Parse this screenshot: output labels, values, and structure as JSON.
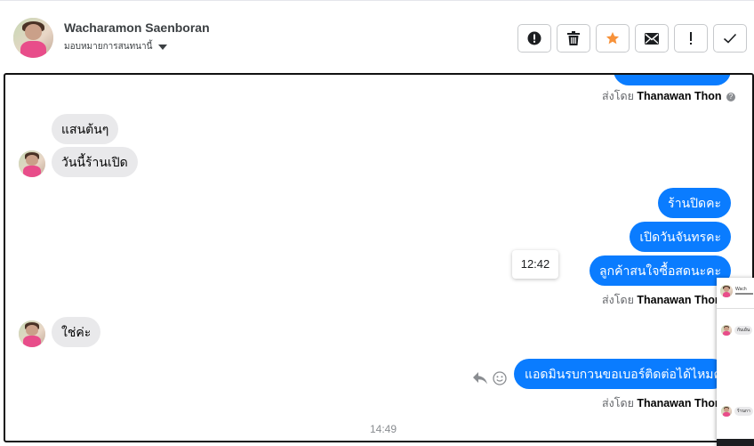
{
  "header": {
    "contact_name": "Wacharamon Saenboran",
    "assign_label": "มอบหมายการสนทนานี้"
  },
  "toolbar": {
    "buttons": [
      {
        "name": "spam",
        "icon": "alert-circle-icon"
      },
      {
        "name": "delete",
        "icon": "trash-icon"
      },
      {
        "name": "star",
        "icon": "star-icon",
        "color": "#f7923a"
      },
      {
        "name": "unread",
        "icon": "envelope-icon"
      },
      {
        "name": "follow-up",
        "icon": "exclamation-icon"
      },
      {
        "name": "done",
        "icon": "check-icon"
      }
    ]
  },
  "messages": {
    "sent_by_prefix": "ส่งโดย",
    "sender_name": "Thanawan Thon",
    "incoming": [
      "แสนต้นๆ",
      "วันนี้ร้านเปิด",
      "ใช่ค่ะ"
    ],
    "outgoing": [
      "ร้านปิดคะ",
      "เปิดวันจันทรคะ",
      "ลูกค้าสนใจซื้อสดนะคะ",
      "แอดมินรบกวนขอเบอร์ติดต่อได้ไหมคะ"
    ],
    "tooltip_time": "12:42",
    "timestamp": "14:49"
  },
  "mini_preview": {
    "name_snippet": "Wach",
    "bubble_1": "กับเย้น",
    "bubble_2": "ร้านกา"
  },
  "colors": {
    "outgoing_bubble": "#0a7cff",
    "incoming_bubble": "#e9e9eb",
    "star_accent": "#f7923a"
  }
}
